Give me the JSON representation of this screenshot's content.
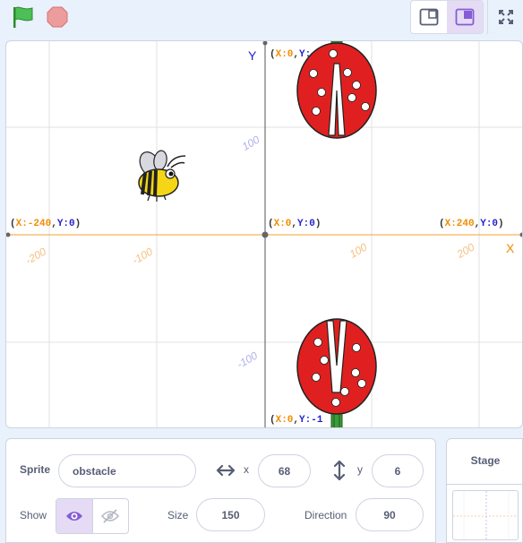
{
  "toolbar": {
    "green_flag_icon": "green-flag-icon",
    "stop_icon": "stop-icon",
    "small_stage_icon": "small-stage-mode-icon",
    "normal_stage_icon": "normal-stage-mode-icon",
    "fullscreen_icon": "fullscreen-icon"
  },
  "stage": {
    "coord_labels": {
      "left": "(X:-240,Y:0)",
      "left_x": "X:-240",
      "left_y": "Y:0",
      "center_x": "X:0",
      "center_y": "Y:0",
      "right_x": "X:240",
      "right_y": "Y:0",
      "top_x": "X:0",
      "top_y": "Y:",
      "bottom_x": "X:0",
      "bottom_y": "Y:-1"
    },
    "axis_x_label": "X",
    "axis_y_label": "Y",
    "tick_x_neg200": "-200",
    "tick_x_neg100": "-100",
    "tick_x_100": "100",
    "tick_x_200": "200",
    "tick_y_100": "100",
    "tick_y_neg100": "-100",
    "colors": {
      "x_color": "#f08c00",
      "y_color": "#1f1fcf",
      "grid": "#e0e0e0",
      "axis_x": "#f0a030",
      "obstacle_red": "#e02020"
    }
  },
  "sprite_info": {
    "sprite_label": "Sprite",
    "sprite_name": "obstacle",
    "x_label": "x",
    "x_value": "68",
    "y_label": "y",
    "y_value": "6",
    "show_label": "Show",
    "size_label": "Size",
    "size_value": "150",
    "direction_label": "Direction",
    "direction_value": "90"
  },
  "stage_panel": {
    "title": "Stage"
  }
}
